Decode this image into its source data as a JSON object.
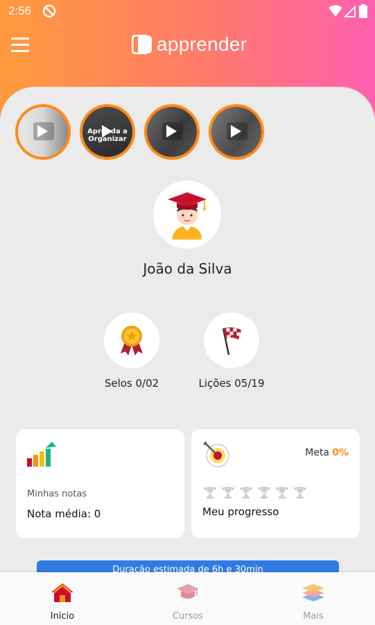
{
  "status": {
    "time": "2:56",
    "icons": [
      "do-not-disturb-icon",
      "wifi-icon",
      "signal-icon",
      "battery-icon"
    ]
  },
  "appbar": {
    "brand": "apprender",
    "menu_icon": "hamburger-menu-icon"
  },
  "stories": [
    {
      "overlay": ""
    },
    {
      "overlay": "Aprenda a Organizar"
    },
    {
      "overlay": ""
    },
    {
      "overlay": ""
    }
  ],
  "profile": {
    "name": "João da Silva"
  },
  "stats": {
    "selos": "Selos 0/02",
    "licoes": "Lições 05/19"
  },
  "cards": {
    "notas": {
      "subtitle": "Minhas notas",
      "main": "Nota média: 0"
    },
    "progresso": {
      "meta_label": "Meta",
      "meta_value": "0%",
      "main": "Meu progresso"
    }
  },
  "duration": "Duração estimada de 6h e 30min",
  "nav": [
    {
      "label": "Inicio",
      "color": "#222222"
    },
    {
      "label": "Cursos",
      "color": "#9a9a9a"
    },
    {
      "label": "Mais",
      "color": "#9a9a9a"
    }
  ],
  "colors": {
    "accent_orange": "#ff8c1a",
    "gradient_start": "#ff9a3c",
    "gradient_end": "#ff5fb0",
    "blue": "#2f7be3"
  }
}
